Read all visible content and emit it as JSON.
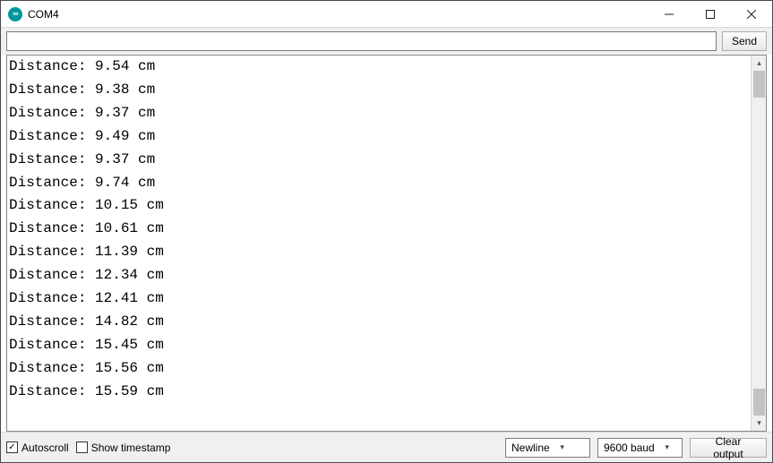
{
  "window": {
    "title": "COM4"
  },
  "toolbar": {
    "send_label": "Send",
    "input_value": "",
    "input_placeholder": ""
  },
  "output": {
    "lines": [
      "Distance: 9.54 cm",
      "Distance: 9.38 cm",
      "Distance: 9.37 cm",
      "Distance: 9.49 cm",
      "Distance: 9.37 cm",
      "Distance: 9.74 cm",
      "Distance: 10.15 cm",
      "Distance: 10.61 cm",
      "Distance: 11.39 cm",
      "Distance: 12.34 cm",
      "Distance: 12.41 cm",
      "Distance: 14.82 cm",
      "Distance: 15.45 cm",
      "Distance: 15.56 cm",
      "Distance: 15.59 cm"
    ]
  },
  "footer": {
    "autoscroll_label": "Autoscroll",
    "autoscroll_checked": true,
    "timestamp_label": "Show timestamp",
    "timestamp_checked": false,
    "line_ending": "Newline",
    "baud": "9600 baud",
    "clear_label": "Clear output"
  }
}
